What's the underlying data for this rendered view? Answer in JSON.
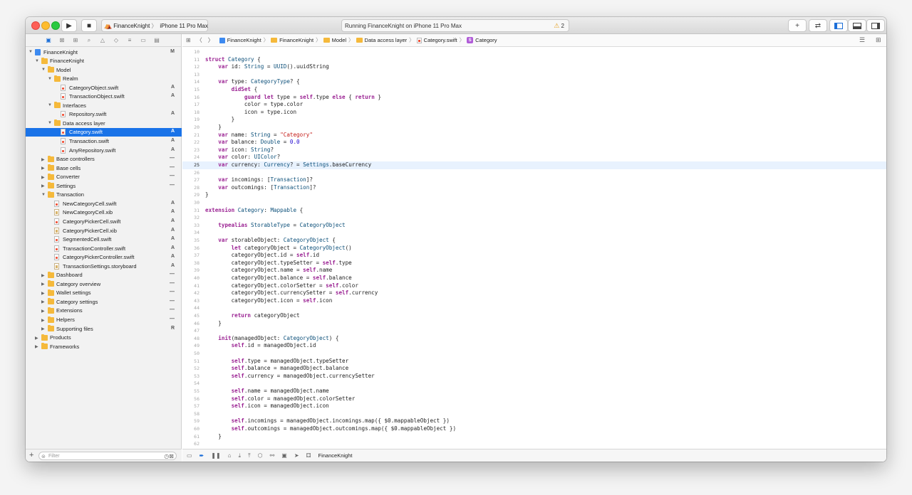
{
  "titlebar": {
    "scheme_app": "FinanceKnight",
    "scheme_device": "iPhone 11 Pro Max",
    "activity_text": "Running FinanceKnight on iPhone 11 Pro Max",
    "warning_count": "2"
  },
  "navigator": {
    "tree": [
      {
        "label": "FinanceKnight",
        "indent": 0,
        "icon": "project",
        "status": "M",
        "open": true
      },
      {
        "label": "FinanceKnight",
        "indent": 1,
        "icon": "folder",
        "status": "",
        "open": true
      },
      {
        "label": "Model",
        "indent": 2,
        "icon": "folder",
        "status": "",
        "open": true
      },
      {
        "label": "Realm",
        "indent": 3,
        "icon": "folder",
        "status": "",
        "open": true
      },
      {
        "label": "CategoryObject.swift",
        "indent": 4,
        "icon": "swift",
        "status": "A"
      },
      {
        "label": "TransactionObject.swift",
        "indent": 4,
        "icon": "swift",
        "status": "A"
      },
      {
        "label": "Interfaces",
        "indent": 3,
        "icon": "folder",
        "status": "",
        "open": true
      },
      {
        "label": "Repository.swift",
        "indent": 4,
        "icon": "swift",
        "status": "A"
      },
      {
        "label": "Data access layer",
        "indent": 3,
        "icon": "folder",
        "status": "",
        "open": true
      },
      {
        "label": "Category.swift",
        "indent": 4,
        "icon": "swift",
        "status": "A",
        "selected": true
      },
      {
        "label": "Transaction.swift",
        "indent": 4,
        "icon": "swift",
        "status": "A"
      },
      {
        "label": "AnyRepository.swift",
        "indent": 4,
        "icon": "swift",
        "status": "A"
      },
      {
        "label": "Base controllers",
        "indent": 2,
        "icon": "folder",
        "status": "—",
        "open": false
      },
      {
        "label": "Base cells",
        "indent": 2,
        "icon": "folder",
        "status": "—",
        "open": false
      },
      {
        "label": "Converter",
        "indent": 2,
        "icon": "folder",
        "status": "—",
        "open": false
      },
      {
        "label": "Settings",
        "indent": 2,
        "icon": "folder",
        "status": "—",
        "open": false
      },
      {
        "label": "Transaction",
        "indent": 2,
        "icon": "folder",
        "status": "",
        "open": true
      },
      {
        "label": "NewCategoryCell.swift",
        "indent": 3,
        "icon": "swift",
        "status": "A"
      },
      {
        "label": "NewCategoryCell.xib",
        "indent": 3,
        "icon": "xib",
        "status": "A"
      },
      {
        "label": "CategoryPickerCell.swift",
        "indent": 3,
        "icon": "swift",
        "status": "A"
      },
      {
        "label": "CategoryPickerCell.xib",
        "indent": 3,
        "icon": "xib",
        "status": "A"
      },
      {
        "label": "SegmentedCell.swift",
        "indent": 3,
        "icon": "swift",
        "status": "A"
      },
      {
        "label": "TransactionController.swift",
        "indent": 3,
        "icon": "swift",
        "status": "A"
      },
      {
        "label": "CategoryPickerController.swift",
        "indent": 3,
        "icon": "swift",
        "status": "A"
      },
      {
        "label": "TransactionSettings.storyboard",
        "indent": 3,
        "icon": "xib",
        "status": "A"
      },
      {
        "label": "Dashboard",
        "indent": 2,
        "icon": "folder",
        "status": "—",
        "open": false
      },
      {
        "label": "Category overview",
        "indent": 2,
        "icon": "folder",
        "status": "—",
        "open": false
      },
      {
        "label": "Wallet settings",
        "indent": 2,
        "icon": "folder",
        "status": "—",
        "open": false
      },
      {
        "label": "Category settings",
        "indent": 2,
        "icon": "folder",
        "status": "—",
        "open": false
      },
      {
        "label": "Extensions",
        "indent": 2,
        "icon": "folder",
        "status": "—",
        "open": false
      },
      {
        "label": "Helpers",
        "indent": 2,
        "icon": "folder",
        "status": "—",
        "open": false
      },
      {
        "label": "Supporting files",
        "indent": 2,
        "icon": "folder",
        "status": "R",
        "open": false
      },
      {
        "label": "Products",
        "indent": 1,
        "icon": "folder",
        "status": "",
        "open": false
      },
      {
        "label": "Frameworks",
        "indent": 1,
        "icon": "folder",
        "status": "",
        "open": false
      }
    ],
    "filter_placeholder": "Filter"
  },
  "jumpbar": {
    "crumbs": [
      {
        "label": "FinanceKnight",
        "icon": "project"
      },
      {
        "label": "FinanceKnight",
        "icon": "folder"
      },
      {
        "label": "Model",
        "icon": "folder"
      },
      {
        "label": "Data access layer",
        "icon": "folder"
      },
      {
        "label": "Category.swift",
        "icon": "swift"
      },
      {
        "label": "Category",
        "icon": "class"
      }
    ]
  },
  "editor": {
    "current_line": 25,
    "first_line": 10,
    "lines": [
      "",
      "struct Category {",
      "    var id: String = UUID().uuidString",
      "",
      "    var type: CategoryType? {",
      "        didSet {",
      "            guard let type = self.type else { return }",
      "            color = type.color",
      "            icon = type.icon",
      "        }",
      "    }",
      "    var name: String = \"Category\"",
      "    var balance: Double = 0.0",
      "    var icon: String?",
      "    var color: UIColor?",
      "    var currency: Currency? = Settings.baseCurrency",
      "",
      "    var incomings: [Transaction]?",
      "    var outcomings: [Transaction]?",
      "}",
      "",
      "extension Category: Mappable {",
      "",
      "    typealias StorableType = CategoryObject",
      "",
      "    var storableObject: CategoryObject {",
      "        let categoryObject = CategoryObject()",
      "        categoryObject.id = self.id",
      "        categoryObject.typeSetter = self.type",
      "        categoryObject.name = self.name",
      "        categoryObject.balance = self.balance",
      "        categoryObject.colorSetter = self.color",
      "        categoryObject.currencySetter = self.currency",
      "        categoryObject.icon = self.icon",
      "",
      "        return categoryObject",
      "    }",
      "",
      "    init(managedObject: CategoryObject) {",
      "        self.id = managedObject.id",
      "",
      "        self.type = managedObject.typeSetter",
      "        self.balance = managedObject.balance",
      "        self.currency = managedObject.currencySetter",
      "",
      "        self.name = managedObject.name",
      "        self.color = managedObject.colorSetter",
      "        self.icon = managedObject.icon",
      "",
      "        self.incomings = managedObject.incomings.map({ $0.mappableObject })",
      "        self.outcomings = managedObject.outcomings.map({ $0.mappableObject })",
      "    }",
      ""
    ]
  },
  "debugbar": {
    "target": "FinanceKnight"
  }
}
